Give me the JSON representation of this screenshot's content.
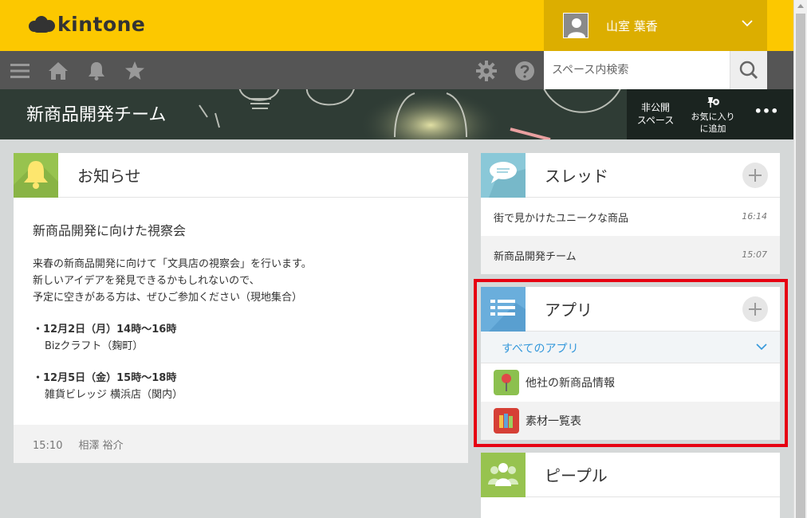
{
  "header": {
    "logo_text": "kintone",
    "user_name": "山室 葉香",
    "search_placeholder": "スペース内検索"
  },
  "space": {
    "title": "新商品開発チーム",
    "action_private": "非公開\nスペース",
    "action_favorite": "お気に入り\nに追加",
    "more": "•••"
  },
  "notice": {
    "title": "お知らせ",
    "heading": "新商品開発に向けた視察会",
    "lines": [
      "来春の新商品開発に向けて「文具店の視察会」を行います。",
      "新しいアイデアを発見できるかもしれないので、",
      "予定に空きがある方は、ぜひご参加ください（現地集合）"
    ],
    "items": [
      {
        "date": "・12月2日（月）14時～16時",
        "place": "Bizクラフト（麹町）"
      },
      {
        "date": "・12月5日（金）15時～18時",
        "place": "雑貨ビレッジ 横浜店（関内）"
      }
    ],
    "footer_time": "15:10",
    "footer_author": "相澤 裕介"
  },
  "threads": {
    "title": "スレッド",
    "items": [
      {
        "name": "街で見かけたユニークな商品",
        "time": "16:14"
      },
      {
        "name": "新商品開発チーム",
        "time": "15:07"
      }
    ]
  },
  "apps": {
    "title": "アプリ",
    "filter": "すべてのアプリ",
    "items": [
      {
        "name": "他社の新商品情報"
      },
      {
        "name": "素材一覧表"
      }
    ]
  },
  "people": {
    "title": "ピープル"
  },
  "colors": {
    "header_yellow": "#fcc800",
    "toolbar_gray": "#555555",
    "link_blue": "#3498db",
    "highlight_red": "#e60012"
  }
}
